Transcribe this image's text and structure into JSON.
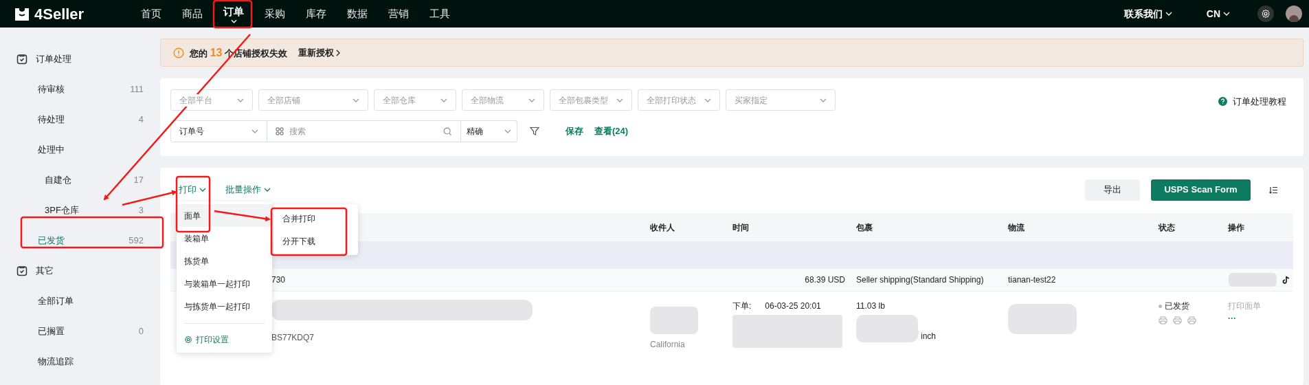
{
  "top_nav": {
    "logo": "4Seller",
    "items": [
      {
        "label": "首页",
        "selected": false
      },
      {
        "label": "商品",
        "selected": false
      },
      {
        "label": "订单",
        "selected": true
      },
      {
        "label": "采购",
        "selected": false
      },
      {
        "label": "库存",
        "selected": false
      },
      {
        "label": "数据",
        "selected": false
      },
      {
        "label": "营销",
        "selected": false
      },
      {
        "label": "工具",
        "selected": false
      }
    ],
    "contact": "联系我们",
    "language": "CN"
  },
  "sidebar": {
    "groups": [
      {
        "title": "订单处理",
        "items": [
          {
            "label": "待审核",
            "count": "111",
            "selected": false
          },
          {
            "label": "待处理",
            "count": "4",
            "selected": false
          },
          {
            "label": "处理中",
            "selected": false,
            "children": [
              {
                "label": "自建仓",
                "count": "17",
                "selected": false
              },
              {
                "label": "3PF仓库",
                "count": "3",
                "selected": false
              }
            ]
          },
          {
            "label": "已发货",
            "count": "592",
            "selected": true
          }
        ]
      },
      {
        "title": "其它",
        "items": [
          {
            "label": "全部订单",
            "selected": false
          },
          {
            "label": "已搁置",
            "count": "0",
            "selected": false
          },
          {
            "label": "物流追踪",
            "selected": false
          }
        ]
      }
    ]
  },
  "alert": {
    "prefix": "您的",
    "count": "13",
    "suffix": "个店铺授权失效",
    "action": "重新授权"
  },
  "filters": {
    "selects": [
      "全部平台",
      "全部店铺",
      "全部仓库",
      "全部物流",
      "全部包裹类型",
      "全部打印状态",
      "买家指定"
    ],
    "search_type": "订单号",
    "search_placeholder": "搜索",
    "match": "精确",
    "save": "保存",
    "view": "查看(24)",
    "tutorial": "订单处理教程"
  },
  "toolbar": {
    "print": "打印",
    "batch": "批量操作",
    "export": "导出",
    "scan_form": "USPS Scan Form"
  },
  "print_menu": {
    "items": [
      {
        "label": "面单",
        "selected": true
      },
      {
        "label": "装箱单",
        "selected": false
      },
      {
        "label": "拣货单",
        "selected": false
      },
      {
        "label": "与装箱单一起打印",
        "selected": false
      },
      {
        "label": "与拣货单一起打印",
        "selected": false
      }
    ],
    "settings": "打印设置"
  },
  "submenu": [
    "合并打印",
    "分开下载"
  ],
  "table": {
    "columns": [
      "收件人",
      "时间",
      "包裹",
      "物流",
      "状态",
      "操作"
    ],
    "order": {
      "number": "730",
      "amount": "68.39 USD",
      "shipping": "Seller shipping(Standard Shipping)",
      "logistics": "tianan-test22",
      "sku": "BS77KDQ7",
      "region": "California",
      "time_label": "下单:",
      "time": "06-03-25 20:01",
      "weight": "11.03 lb",
      "size_unit": "inch",
      "status": "已发货",
      "action": "打印面单",
      "more": "···"
    }
  }
}
